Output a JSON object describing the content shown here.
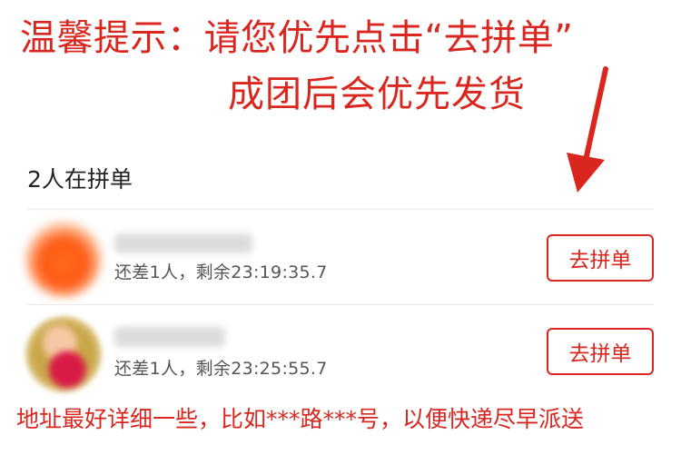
{
  "notice": {
    "line1": "温馨提示：请您优先点击“去拼单”",
    "line2": "成团后会优先发货",
    "color": "#d9271f"
  },
  "section": {
    "title": "2人在拼单"
  },
  "groups": [
    {
      "status": "还差1人，剩余23:19:35.7",
      "button_label": "去拼单"
    },
    {
      "status": "还差1人，剩余23:25:55.7",
      "button_label": "去拼单"
    }
  ],
  "footer_note": "地址最好详细一些，比如***路***号，以便快递尽早派送",
  "icons": {
    "annotation_arrow": "arrow-down-icon"
  }
}
